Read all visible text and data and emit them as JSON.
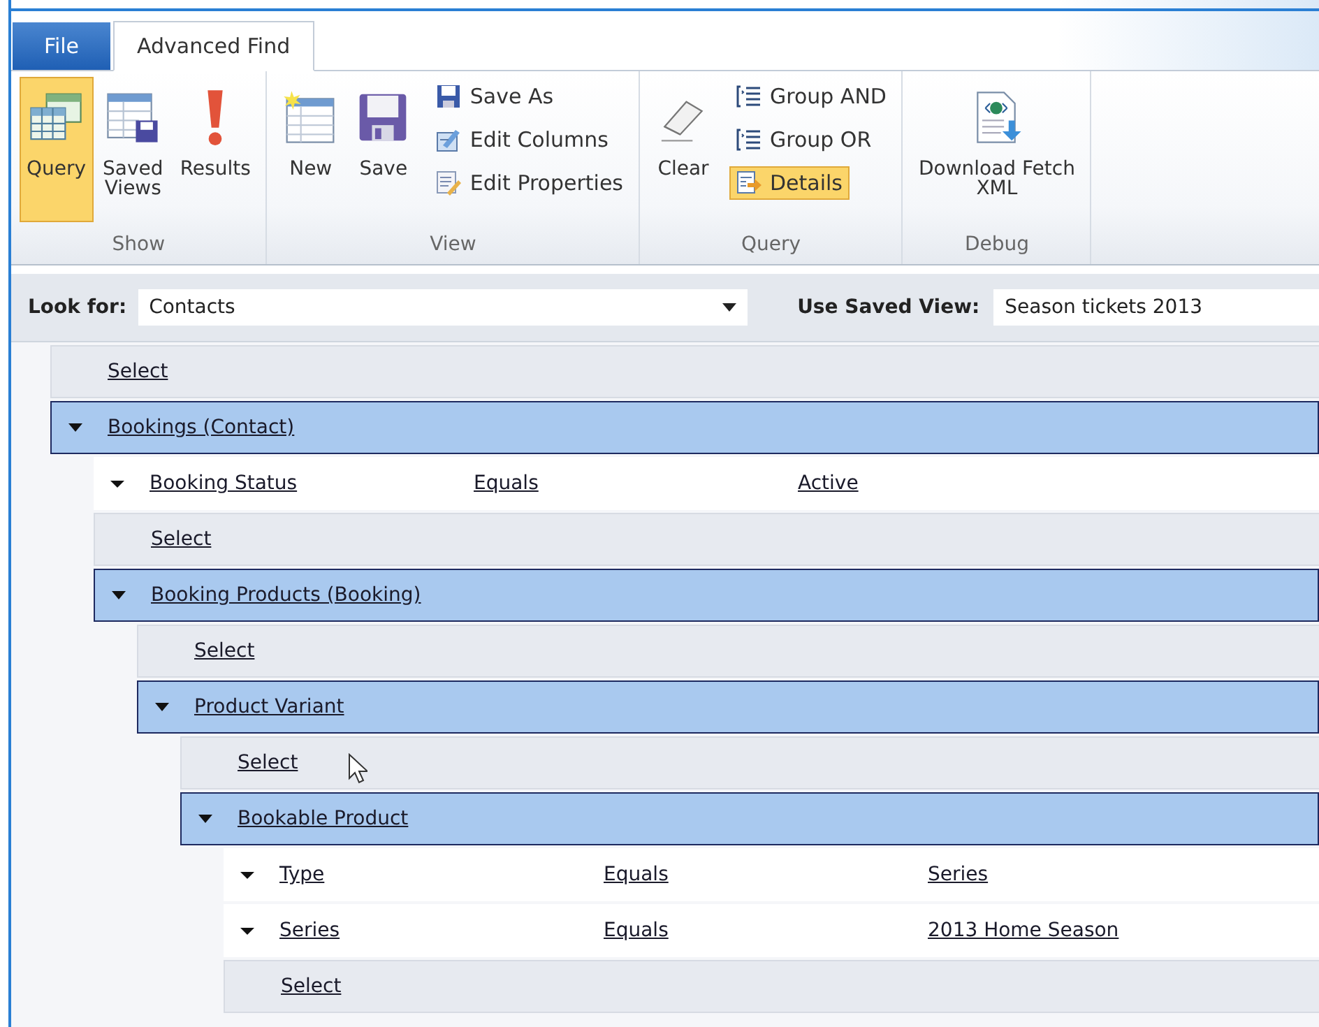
{
  "tabs": [
    {
      "label": "File",
      "kind": "file",
      "selected": false
    },
    {
      "label": "Advanced Find",
      "kind": "tab",
      "selected": true
    }
  ],
  "ribbon": {
    "groups": [
      {
        "label": "Show",
        "items": [
          {
            "kind": "large",
            "lines": [
              "Query"
            ],
            "selected": true
          },
          {
            "kind": "large",
            "lines": [
              "Saved",
              "Views"
            ],
            "selected": false
          },
          {
            "kind": "large",
            "lines": [
              "Results"
            ],
            "selected": false
          }
        ]
      },
      {
        "label": "View",
        "items": [
          {
            "kind": "large",
            "lines": [
              "New"
            ],
            "selected": false
          },
          {
            "kind": "large",
            "lines": [
              "Save"
            ],
            "selected": false
          },
          {
            "kind": "small",
            "lines": [
              "Save As"
            ],
            "selected": false
          },
          {
            "kind": "small",
            "lines": [
              "Edit Columns"
            ],
            "selected": false
          },
          {
            "kind": "small",
            "lines": [
              "Edit Properties"
            ],
            "selected": false
          }
        ]
      },
      {
        "label": "Query",
        "items": [
          {
            "kind": "large",
            "lines": [
              "Clear"
            ],
            "selected": false
          },
          {
            "kind": "small",
            "lines": [
              "Group AND"
            ],
            "selected": false
          },
          {
            "kind": "small",
            "lines": [
              "Group OR"
            ],
            "selected": false
          },
          {
            "kind": "small",
            "lines": [
              "Details"
            ],
            "selected": true
          }
        ]
      },
      {
        "label": "Debug",
        "items": [
          {
            "kind": "large",
            "lines": [
              "Download Fetch",
              "XML"
            ],
            "selected": false
          }
        ]
      }
    ]
  },
  "look_for": {
    "label": "Look for:",
    "value": "Contacts"
  },
  "saved_view": {
    "label": "Use Saved View:",
    "value": "Season tickets 2013"
  },
  "query": {
    "children": [
      {
        "kind": "select",
        "label": "Select"
      },
      {
        "kind": "entity",
        "label": "Bookings (Contact)",
        "expanded": true,
        "children": [
          {
            "kind": "condition",
            "field": "Booking Status",
            "operator": "Equals",
            "value": "Active"
          },
          {
            "kind": "select",
            "label": "Select"
          },
          {
            "kind": "entity",
            "label": "Booking Products (Booking)",
            "expanded": true,
            "children": [
              {
                "kind": "select",
                "label": "Select"
              },
              {
                "kind": "entity",
                "label": "Product Variant",
                "expanded": true,
                "children": [
                  {
                    "kind": "select",
                    "label": "Select"
                  },
                  {
                    "kind": "entity",
                    "label": "Bookable Product",
                    "expanded": true,
                    "children": [
                      {
                        "kind": "condition",
                        "field": "Type",
                        "operator": "Equals",
                        "value": "Series"
                      },
                      {
                        "kind": "condition",
                        "field": "Series",
                        "operator": "Equals",
                        "value": "2013 Home Season"
                      },
                      {
                        "kind": "select",
                        "label": "Select"
                      }
                    ]
                  }
                ]
              }
            ]
          }
        ]
      }
    ]
  }
}
